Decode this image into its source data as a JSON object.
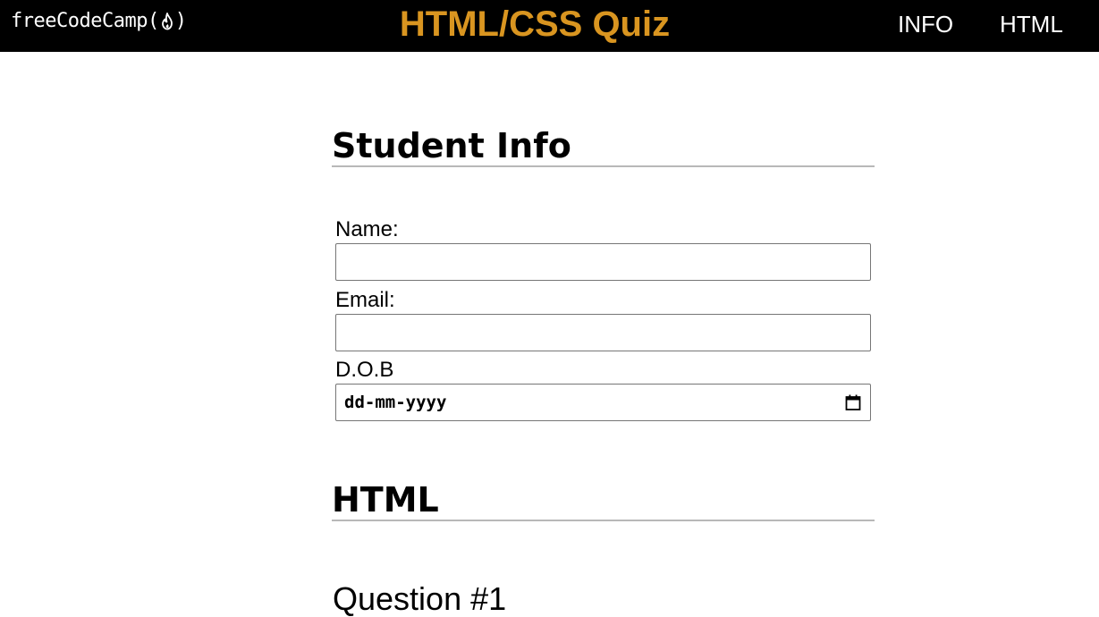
{
  "navbar": {
    "logo_text_before": "freeCodeCamp(",
    "logo_text_after": ")",
    "logo_icon": "flame-icon",
    "title": "HTML/CSS Quiz",
    "title_color": "#d99520",
    "links": [
      {
        "label": "INFO"
      },
      {
        "label": "HTML"
      }
    ]
  },
  "student_info": {
    "heading": "Student Info",
    "name_label": "Name:",
    "name_value": "",
    "email_label": "Email:",
    "email_value": "",
    "dob_label": "D.O.B",
    "dob_placeholder": "dd-mm-yyyy",
    "dob_icon": "calendar-icon"
  },
  "html_section": {
    "heading": "HTML",
    "question_title": "Question #1"
  }
}
